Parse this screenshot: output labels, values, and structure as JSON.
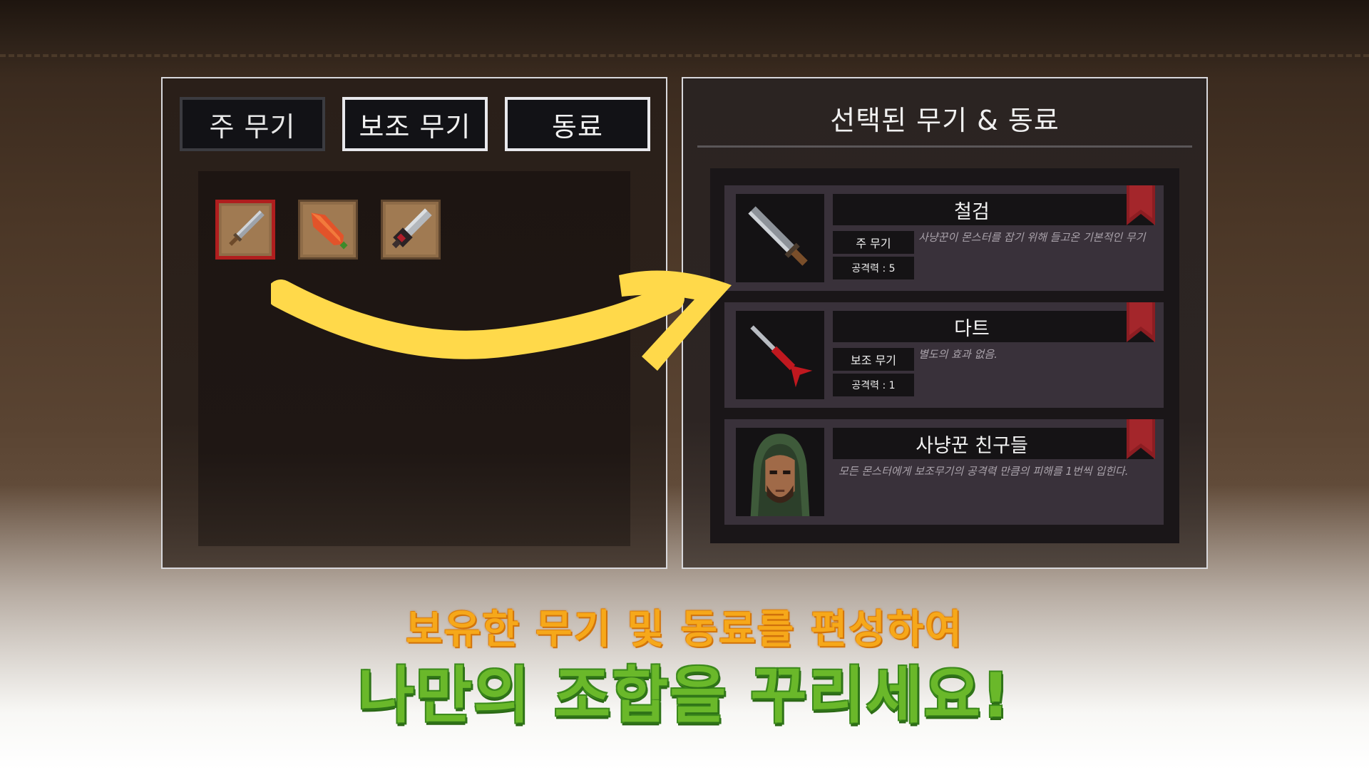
{
  "tabs": {
    "main": "주 무기",
    "sub": "보조 무기",
    "friend": "동료"
  },
  "inventory": {
    "items": [
      "sword-icon",
      "carrot-icon",
      "chainsaw-icon"
    ],
    "selected_index": 0
  },
  "selected_panel": {
    "title": "선택된 무기 & 동료",
    "cards": [
      {
        "name": "철검",
        "type": "주 무기",
        "attack": "공격력 : 5",
        "description": "사냥꾼이 몬스터를 잡기 위해 들고온 기본적인 무기",
        "icon": "sword-icon"
      },
      {
        "name": "다트",
        "type": "보조 무기",
        "attack": "공격력 : 1",
        "description": "별도의 효과 없음.",
        "icon": "dart-icon"
      },
      {
        "name": "사냥꾼 친구들",
        "description": "모든 몬스터에게 보조무기의 공격력 만큼의 피해를 1번씩 입힌다.",
        "icon": "hooded-hunter-portrait"
      }
    ]
  },
  "caption": {
    "line1": "보유한 무기 및 동료를 편성하여",
    "line2": "나만의 조합을 꾸리세요!"
  },
  "colors": {
    "accent_yellow": "#ffd94a",
    "caption_orange": "#f6a81a",
    "caption_green": "#6ab82a",
    "selection_red": "#b01e1e",
    "bookmark_red": "#8c1d22"
  }
}
